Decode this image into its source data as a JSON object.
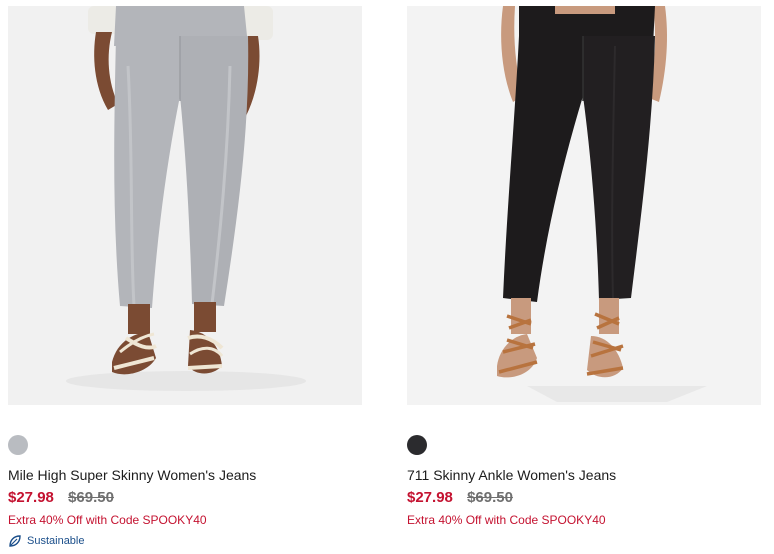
{
  "products": [
    {
      "title": "Mile High Super Skinny Women's Jeans",
      "price_sale": "$27.98",
      "price_original": "$69.50",
      "promo": "Extra 40% Off with Code SPOOKY40",
      "badge": "Sustainable",
      "swatch_color": "#b9bcc1",
      "swatch_name": "light-grey",
      "image_bg": "#f1f1f1",
      "jeans_color": "#b3b5ba",
      "shoe_color": "#efe6d4"
    },
    {
      "title": "711 Skinny Ankle Women's Jeans",
      "price_sale": "$27.98",
      "price_original": "$69.50",
      "promo": "Extra 40% Off with Code SPOOKY40",
      "swatch_color": "#2b2b2e",
      "swatch_name": "black",
      "image_bg": "#f3f3f3",
      "jeans_color": "#1d1b1c",
      "shoe_color": "#b8733e"
    }
  ],
  "colors": {
    "sale_red": "#c41230",
    "strike_grey": "#6f6f6f",
    "sustain_blue": "#1a4e8a"
  },
  "icons": {
    "sustainable": "leaf-icon"
  }
}
